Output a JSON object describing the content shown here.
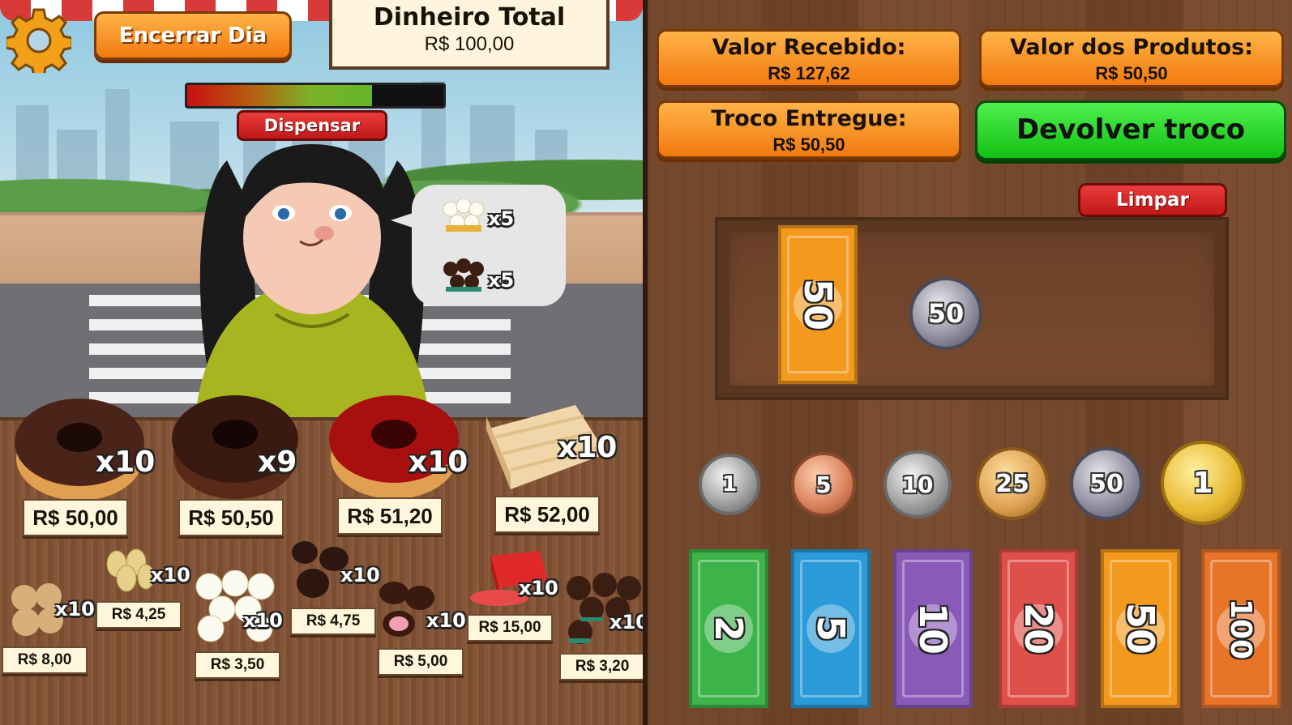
{
  "hud": {
    "end_day_label": "Encerrar Dia",
    "total_money_title": "Dinheiro Total",
    "total_money_value": "R$ 100,00",
    "dismiss_label": "Dispensar",
    "patience_fraction": 0.72
  },
  "request": {
    "items": [
      {
        "product": "coconut-sweet",
        "quantity": "x5"
      },
      {
        "product": "brigadeiro",
        "quantity": "x5"
      }
    ]
  },
  "products": {
    "big": [
      {
        "name": "chocolate-donut",
        "quantity": "x10",
        "price": "R$ 50,00"
      },
      {
        "name": "chocolate-donut-dark",
        "quantity": "x9",
        "price": "R$ 50,50"
      },
      {
        "name": "strawberry-donut",
        "quantity": "x10",
        "price": "R$ 51,20"
      },
      {
        "name": "pie-slice",
        "quantity": "x10",
        "price": "R$ 52,00"
      }
    ],
    "small": [
      {
        "name": "peanut-balls",
        "quantity": "x10",
        "price": "R$ 8,00"
      },
      {
        "name": "pacoca",
        "quantity": "x10",
        "price": "R$ 4,25"
      },
      {
        "name": "coconut-sweet",
        "quantity": "x10",
        "price": "R$ 3,50"
      },
      {
        "name": "bombom",
        "quantity": "x10",
        "price": "R$ 4,75"
      },
      {
        "name": "strawberry-bombom",
        "quantity": "x10",
        "price": "R$ 5,00"
      },
      {
        "name": "guava-paste",
        "quantity": "x10",
        "price": "R$ 15,00"
      },
      {
        "name": "brigadeiro",
        "quantity": "x10",
        "price": "R$ 3,20"
      }
    ]
  },
  "register": {
    "received_label": "Valor Recebido:",
    "received_value": "R$ 127,62",
    "products_label": "Valor dos Produtos:",
    "products_value": "R$ 50,50",
    "change_label": "Troco Entregue:",
    "change_value": "R$ 50,50",
    "return_change_label": "Devolver troco",
    "clear_label": "Limpar"
  },
  "tray": {
    "note": "50",
    "coin": "50"
  },
  "coins": [
    "1",
    "5",
    "10",
    "25",
    "50",
    "1"
  ],
  "notes": [
    "2",
    "5",
    "10",
    "20",
    "50",
    "100"
  ],
  "colors": {
    "note_2": "#3cb44a",
    "note_5": "#2a9ad8",
    "note_10": "#8a5ab8",
    "note_20": "#e0504a",
    "note_50": "#f39a1e",
    "note_100": "#e8742a"
  }
}
